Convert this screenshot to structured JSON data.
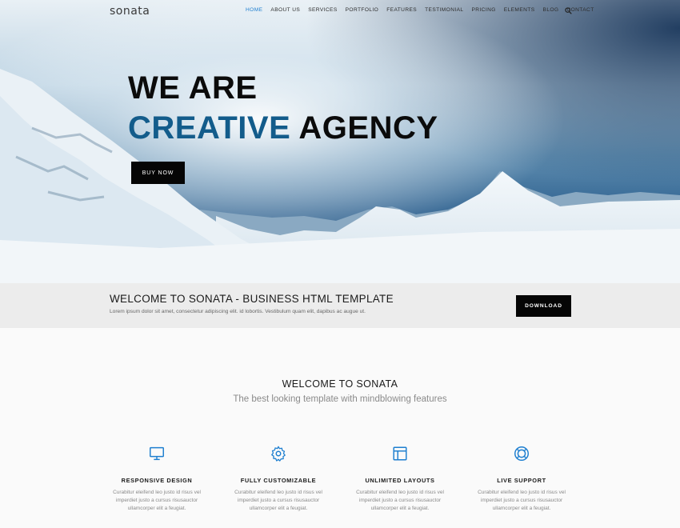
{
  "brand": {
    "logo_text": "sonata"
  },
  "nav": {
    "items": [
      "HOME",
      "ABOUT US",
      "SERVICES",
      "PORTFOLIO",
      "FEATURES",
      "TESTIMONIAL",
      "PRICING",
      "ELEMENTS",
      "BLOG",
      "CONTACT"
    ],
    "active_index": 0,
    "search_icon": "search-icon"
  },
  "hero": {
    "line1": "WE ARE",
    "line2_blue": "CREATIVE",
    "line2_dark": "AGENCY",
    "cta_label": "BUY NOW"
  },
  "band": {
    "title": "WELCOME TO SONATA - BUSINESS HTML TEMPLATE",
    "subtitle": "Lorem ipsum dolor sit amet, consectetur adipiscing elit. id lobortis. Vestibulum quam elit, dapibus ac augue ut.",
    "download_label": "DOWNLOAD"
  },
  "welcome": {
    "title": "WELCOME TO SONATA",
    "subtitle": "The best looking template with mindblowing features"
  },
  "features": [
    {
      "icon": "monitor-icon",
      "title": "RESPONSIVE DESIGN",
      "desc": "Curabitur eleifend leo justo id risus vel imperdiet justo a cursus risusauctor ullamcorper elit a feugiat."
    },
    {
      "icon": "gear-icon",
      "title": "FULLY CUSTOMIZABLE",
      "desc": "Curabitur eleifend leo justo id risus vel imperdiet justo a cursus risusauctor ullamcorper elit a feugiat."
    },
    {
      "icon": "layout-icon",
      "title": "UNLIMITED LAYOUTS",
      "desc": "Curabitur eleifend leo justo id risus vel imperdiet justo a cursus risusauctor ullamcorper elit a feugiat."
    },
    {
      "icon": "lifebuoy-icon",
      "title": "LIVE SUPPORT",
      "desc": "Curabitur eleifend leo justo id risus vel imperdiet justo a cursus risusauctor ullamcorper elit a feugiat."
    }
  ],
  "colors": {
    "accent": "#1e7fd0",
    "hero_blue_text": "#135c8b",
    "button_bg": "#050505",
    "band_bg": "#ececec"
  }
}
